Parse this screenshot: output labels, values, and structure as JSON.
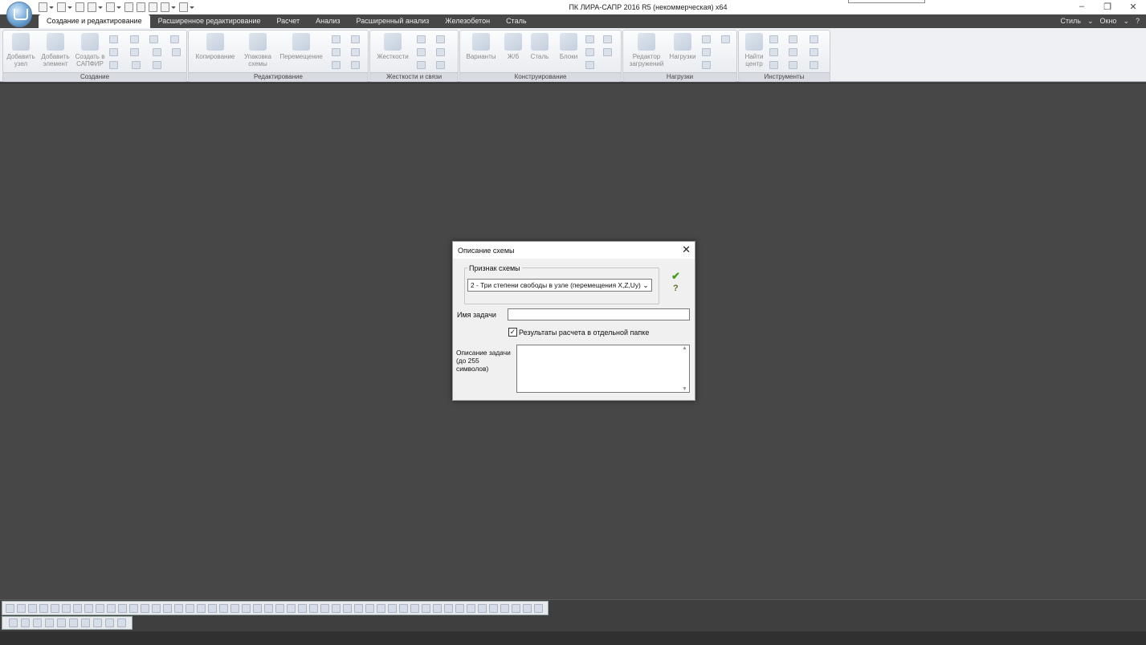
{
  "app": {
    "title": "ПК ЛИРА-САПР  2016 R5 (некоммерческая) x64"
  },
  "tabs": [
    {
      "label": "Создание и редактирование"
    },
    {
      "label": "Расширенное редактирование"
    },
    {
      "label": "Расчет"
    },
    {
      "label": "Анализ"
    },
    {
      "label": "Расширенный анализ"
    },
    {
      "label": "Железобетон"
    },
    {
      "label": "Сталь"
    }
  ],
  "rightmenu": {
    "style": "Стиль",
    "window": "Окно"
  },
  "ribbon": {
    "groups": [
      {
        "label": "Создание",
        "buttons": [
          "Добавить узел",
          "Добавить элемент",
          "Создать в САПФИР"
        ]
      },
      {
        "label": "Редактирование",
        "buttons": [
          "Копирование",
          "Упаковка схемы",
          "Перемещение"
        ]
      },
      {
        "label": "Жесткости и связи",
        "buttons": [
          "Жесткости"
        ]
      },
      {
        "label": "Конструирование",
        "buttons": [
          "Варианты",
          "Ж/б",
          "Сталь",
          "Блоки"
        ]
      },
      {
        "label": "Нагрузки",
        "buttons": [
          "Редактор загружений",
          "Нагрузки"
        ]
      },
      {
        "label": "Инструменты",
        "buttons": [
          "Найти центр"
        ]
      }
    ]
  },
  "dialog": {
    "title": "Описание схемы",
    "scheme_group_label": "Признак схемы",
    "scheme_value": "2 - Три степени свободы в узле (перемещения X,Z,Uy) >",
    "task_name_label": "Имя задачи",
    "task_name_value": "",
    "checkbox_label": "Результаты расчета в отдельной папке",
    "checkbox_checked": true,
    "desc_label_1": "Описание задачи",
    "desc_label_2": "(до 255 символов)",
    "desc_value": ""
  }
}
